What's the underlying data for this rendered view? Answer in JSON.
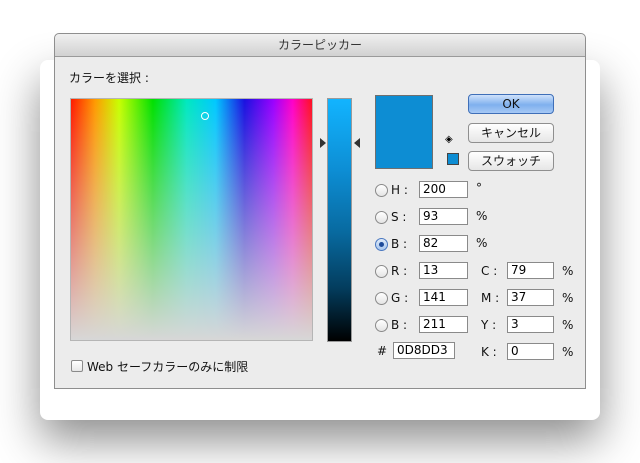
{
  "window": {
    "title": "カラーピッカー"
  },
  "picker": {
    "select_label": "カラーを選択 :"
  },
  "buttons": {
    "ok": "OK",
    "cancel": "キャンセル",
    "swatches": "スウォッチ"
  },
  "hsb": {
    "h": {
      "label": "H :",
      "value": "200",
      "unit": "°",
      "selected": false
    },
    "s": {
      "label": "S :",
      "value": "93",
      "unit": "%",
      "selected": false
    },
    "b": {
      "label": "B :",
      "value": "82",
      "unit": "%",
      "selected": true
    }
  },
  "rgb": {
    "r": {
      "label": "R :",
      "value": "13"
    },
    "g": {
      "label": "G :",
      "value": "141"
    },
    "b": {
      "label": "B :",
      "value": "211"
    }
  },
  "cmyk": {
    "c": {
      "label": "C :",
      "value": "79",
      "unit": "%"
    },
    "m": {
      "label": "M :",
      "value": "37",
      "unit": "%"
    },
    "y": {
      "label": "Y :",
      "value": "3",
      "unit": "%"
    },
    "k": {
      "label": "K :",
      "value": "0",
      "unit": "%"
    }
  },
  "hex": {
    "label": "#",
    "value": "0D8DD3"
  },
  "web_safe": {
    "label": "Web セーフカラーのみに制限",
    "checked": false
  },
  "colors": {
    "current": "#0d8dd3",
    "ok_button_accent": "#7fb0ee"
  },
  "icons": {
    "cube": "cube-icon",
    "web-swatch": "web-swatch-icon"
  }
}
